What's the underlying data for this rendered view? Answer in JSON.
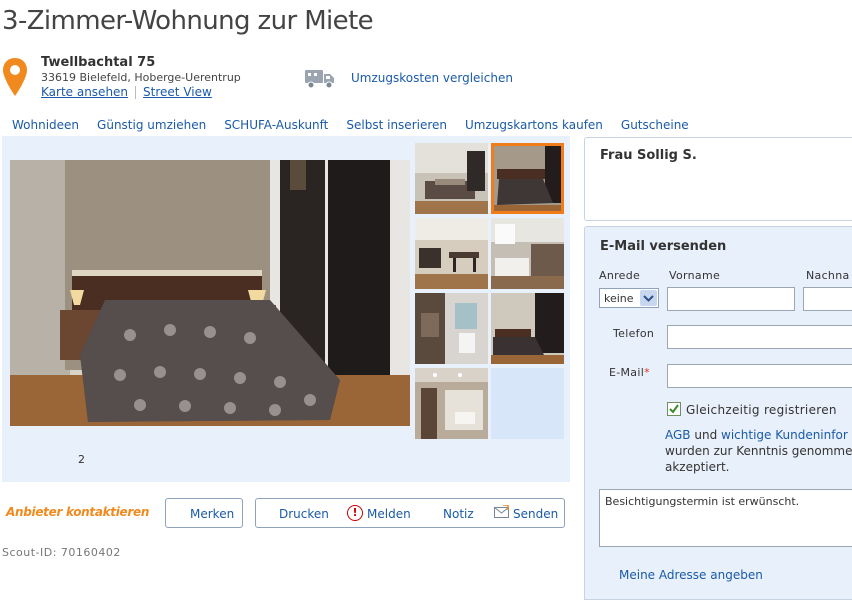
{
  "title": "3-Zimmer-Wohnung zur Miete",
  "address": {
    "street": "Twellbachtal 75",
    "city": "33619 Bielefeld, Hoberge-Uerentrup",
    "map_link": "Karte ansehen",
    "street_view_link": "Street View"
  },
  "moving_costs_link": "Umzugskosten vergleichen",
  "nav": [
    "Wohnideen",
    "Günstig umziehen",
    "SCHUFA-Auskunft",
    "Selbst inserieren",
    "Umzugskartons kaufen",
    "Gutscheine"
  ],
  "gallery": {
    "image_number": "2"
  },
  "actions": {
    "contact_provider": "Anbieter kontaktieren",
    "merken": "Merken",
    "drucken": "Drucken",
    "melden": "Melden",
    "notiz": "Notiz",
    "senden": "Senden"
  },
  "scout_id": "Scout-ID: 70160402",
  "contact": {
    "name": "Frau Sollig S."
  },
  "mail_form": {
    "title": "E-Mail versenden",
    "anrede_label": "Anrede",
    "anrede_value": "keine",
    "vorname_label": "Vorname",
    "nachname_label": "Nachna",
    "telefon_label": "Telefon",
    "email_label": "E-Mail",
    "email_required": "*",
    "register_label": "Gleichzeitig registrieren",
    "register_checked": true,
    "terms_agb": "AGB",
    "terms_und": "und",
    "terms_hints": "wichtige Kundeninfor",
    "terms_line2": "wurden zur Kenntnis genomme",
    "terms_line3": "akzeptiert.",
    "message": "Besichtigungstermin ist erwünscht.",
    "address_link": "Meine Adresse angeben"
  },
  "colors": {
    "link": "#1a5aa8",
    "accent_orange": "#f07d1a",
    "panel_bg": "#e8f0fb"
  }
}
